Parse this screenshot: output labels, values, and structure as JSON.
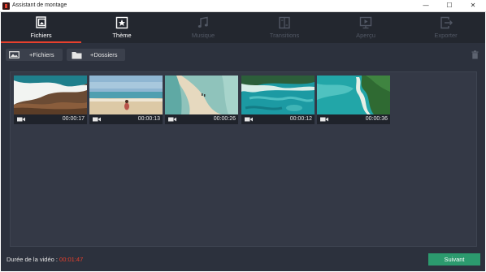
{
  "window": {
    "title": "Assistant de montage",
    "minimize_glyph": "—",
    "maximize_glyph": "☐",
    "close_glyph": "✕"
  },
  "tabs": [
    {
      "label": "Fichiers",
      "icon": "files-icon",
      "state": "active"
    },
    {
      "label": "Thème",
      "icon": "theme-icon",
      "state": "enabled"
    },
    {
      "label": "Musique",
      "icon": "music-icon",
      "state": "disabled"
    },
    {
      "label": "Transitions",
      "icon": "transitions-icon",
      "state": "disabled"
    },
    {
      "label": "Aperçu",
      "icon": "preview-icon",
      "state": "disabled"
    },
    {
      "label": "Exporter",
      "icon": "export-icon",
      "state": "disabled"
    }
  ],
  "actions": {
    "add_files_label": "+Fichiers",
    "add_folders_label": "+Dossiers",
    "delete_icon": "trash-icon"
  },
  "clips": [
    {
      "duration": "00:00:17",
      "scene": "waves-on-shore"
    },
    {
      "duration": "00:00:13",
      "scene": "person-on-beach"
    },
    {
      "duration": "00:00:26",
      "scene": "aerial-sandbar"
    },
    {
      "duration": "00:00:12",
      "scene": "aerial-reef"
    },
    {
      "duration": "00:00:36",
      "scene": "aerial-lagoon-coast"
    }
  ],
  "footer": {
    "duration_label": "Durée de la vidéo : ",
    "duration_value": "00:01:47",
    "next_label": "Suivant"
  },
  "colors": {
    "accent": "#e7402d",
    "next_button": "#2c9a6e",
    "panel_bg": "#2c313d",
    "tabbar_bg": "#23272f"
  }
}
